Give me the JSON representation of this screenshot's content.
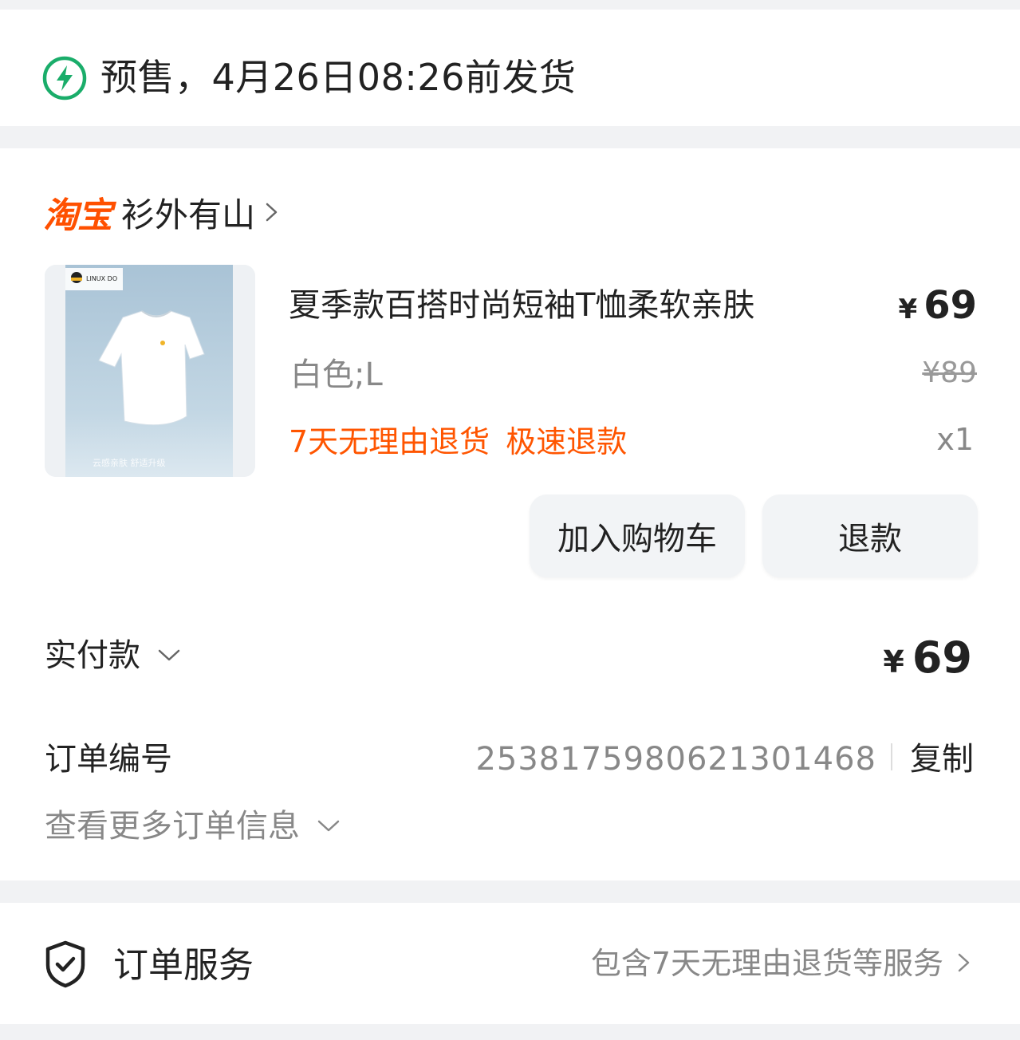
{
  "presale": {
    "icon": "lightning-circle-icon",
    "text": "预售，4月26日08:26前发货"
  },
  "shop": {
    "platform_logo": "淘宝",
    "name": "衫外有山"
  },
  "item": {
    "title": "夏季款百搭时尚短袖T恤柔软亲肤",
    "price_symbol": "¥",
    "price": "69",
    "original_price": "¥89",
    "spec": "白色;L",
    "tags": [
      "7天无理由退货",
      "极速退款"
    ],
    "quantity": "x1",
    "thumbnail": {
      "brand_label": "LINUX DO",
      "caption": "云感亲肤 舒适升级"
    }
  },
  "actions": {
    "add_to_cart": "加入购物车",
    "refund": "退款"
  },
  "payment": {
    "label": "实付款",
    "symbol": "¥",
    "amount": "69"
  },
  "order": {
    "number_label": "订单编号",
    "number": "2538175980621301468",
    "copy": "复制",
    "more_info": "查看更多订单信息"
  },
  "service": {
    "label": "订单服务",
    "description": "包含7天无理由退货等服务"
  },
  "colors": {
    "accent_orange": "#ff5500",
    "presale_green": "#1aad6a",
    "background": "#f1f2f4"
  }
}
